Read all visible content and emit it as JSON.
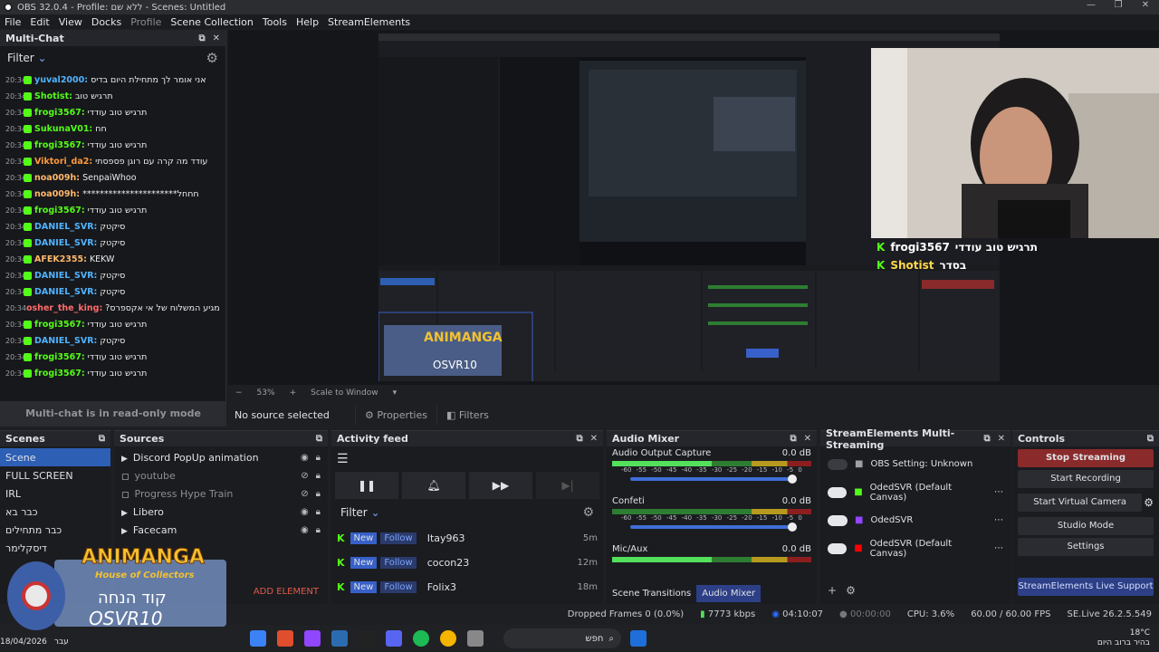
{
  "window": {
    "title": "OBS 32.0.4 - Profile: ללא שם - Scenes: Untitled"
  },
  "menu": [
    "File",
    "Edit",
    "View",
    "Docks",
    "Profile",
    "Scene Collection",
    "Tools",
    "Help",
    "StreamElements"
  ],
  "multichat": {
    "title": "Multi-Chat",
    "filter_label": "Filter",
    "readonly_text": "Multi-chat is in read-only mode",
    "lines": [
      {
        "time": "20:34",
        "user": "yuval2000:",
        "msg": "אני אומר לך מתחילת היום בדיס",
        "color": "#4fb3ff"
      },
      {
        "time": "20:34",
        "user": "Shotist:",
        "msg": "תרגיש טוב",
        "color": "#53fc18"
      },
      {
        "time": "20:34",
        "user": "frogi3567:",
        "msg": "תרגיש טוב עודדי",
        "color": "#53fc18"
      },
      {
        "time": "20:34",
        "user": "SukunaV01:",
        "msg": "חח",
        "color": "#53fc18"
      },
      {
        "time": "20:34",
        "user": "frogi3567:",
        "msg": "תרגיש טוב עודדי",
        "color": "#53fc18"
      },
      {
        "time": "20:34",
        "user": "Viktori_da2:",
        "msg": "עודד מה קרה עם רוגן פספסתי",
        "color": "#ff9a3c"
      },
      {
        "time": "20:34",
        "user": "noa009h:",
        "msg": "SenpaiWhoo",
        "color": "#ffb86b"
      },
      {
        "time": "20:34",
        "user": "noa009h:",
        "msg": "**********************חחחל",
        "color": "#ffb86b"
      },
      {
        "time": "20:34",
        "user": "frogi3567:",
        "msg": "תרגיש טוב עודדי",
        "color": "#53fc18"
      },
      {
        "time": "20:34",
        "user": "DANIEL_SVR:",
        "msg": "סיקטק",
        "color": "#4fb3ff"
      },
      {
        "time": "20:34",
        "user": "DANIEL_SVR:",
        "msg": "סיקטק",
        "color": "#4fb3ff"
      },
      {
        "time": "20:34",
        "user": "AFEK2355:",
        "msg": "KEKW",
        "color": "#ffb86b"
      },
      {
        "time": "20:34",
        "user": "DANIEL_SVR:",
        "msg": "סיקטק",
        "color": "#4fb3ff"
      },
      {
        "time": "20:34",
        "user": "DANIEL_SVR:",
        "msg": "סיקטק",
        "color": "#4fb3ff"
      },
      {
        "time": "20:34",
        "user": "osher_the_king:",
        "msg": "?מתי מגיע המשלוח של אי אקספרס",
        "color": "#ff6b6b"
      },
      {
        "time": "20:34",
        "user": "frogi3567:",
        "msg": "תרגיש טוב עודדי",
        "color": "#53fc18"
      },
      {
        "time": "20:34",
        "user": "DANIEL_SVR:",
        "msg": "סיקטק",
        "color": "#4fb3ff"
      },
      {
        "time": "20:34",
        "user": "frogi3567:",
        "msg": "תרגיש טוב עודדי",
        "color": "#53fc18"
      },
      {
        "time": "20:34",
        "user": "frogi3567:",
        "msg": "תרגיש טוב עודדי",
        "color": "#53fc18"
      },
      {
        "time": "20:34",
        "user": "Shotist:",
        "msg": "בסדר",
        "color": "#53fc18"
      }
    ]
  },
  "preview": {
    "zoom": "53%",
    "scale_mode": "Scale to Window",
    "overlay_lines": [
      {
        "user": "frogi3567",
        "msg": "תרגיש טוב עודדי",
        "color": "#ffffff"
      },
      {
        "user": "Shotist",
        "msg": "בסדר",
        "color": "#ffd84a"
      }
    ]
  },
  "sourcebar": {
    "no_source": "No source selected",
    "properties": "Properties",
    "filters": "Filters"
  },
  "scenes": {
    "title": "Scenes",
    "items": [
      "Scene",
      "FULL SCREEN",
      "IRL",
      "כבר בא",
      "כבר מתחילים",
      "דיסקלימר"
    ],
    "selected": 0
  },
  "sources": {
    "title": "Sources",
    "add_label": "ADD ELEMENT",
    "items": [
      {
        "name": "Discord PopUp animation",
        "dim": false
      },
      {
        "name": "youtube",
        "dim": true
      },
      {
        "name": "Progress Hype Train",
        "dim": true
      },
      {
        "name": "Libero",
        "dim": false
      },
      {
        "name": "Facecam",
        "dim": false
      }
    ]
  },
  "activity": {
    "title": "Activity feed",
    "filter_label": "Filter",
    "new_label": "New",
    "follow_label": "Follow",
    "items": [
      {
        "user": "Itay963",
        "age": "5m"
      },
      {
        "user": "cocon23",
        "age": "12m"
      },
      {
        "user": "Folix3",
        "age": "18m"
      }
    ]
  },
  "mixer": {
    "title": "Audio Mixer",
    "channels": [
      {
        "name": "Audio Output Capture",
        "db": "0.0 dB",
        "hot": true
      },
      {
        "name": "Confeti",
        "db": "0.0 dB",
        "hot": false
      },
      {
        "name": "Mic/Aux",
        "db": "0.0 dB",
        "hot": true
      }
    ],
    "ticks": [
      "-60",
      "-55",
      "-50",
      "-45",
      "-40",
      "-35",
      "-30",
      "-25",
      "-20",
      "-15",
      "-10",
      "-5",
      "0"
    ],
    "tab_transitions": "Scene Transitions",
    "tab_mixer": "Audio Mixer"
  },
  "se_multi": {
    "title": "StreamElements Multi-Streaming",
    "rows": [
      {
        "label": "OBS Setting: Unknown",
        "on": false,
        "platform": "obs",
        "color": "#9aa0a6"
      },
      {
        "label": "OdedSVR (Default Canvas)",
        "on": true,
        "platform": "kick",
        "color": "#53fc18"
      },
      {
        "label": "OdedSVR",
        "on": true,
        "platform": "twitch",
        "color": "#9146ff"
      },
      {
        "label": "OdedSVR (Default Canvas)",
        "on": true,
        "platform": "youtube",
        "color": "#ff0000"
      }
    ]
  },
  "controls": {
    "title": "Controls",
    "stop_streaming": "Stop Streaming",
    "start_recording": "Start Recording",
    "start_virtual_camera": "Start Virtual Camera",
    "studio_mode": "Studio Mode",
    "settings": "Settings",
    "support": "StreamElements Live Support"
  },
  "status": {
    "dropped": "Dropped Frames 0 (0.0%)",
    "kbps": "7773 kbps",
    "live_time": "04:10:07",
    "rec_time": "00:00:00",
    "cpu": "CPU: 3.6%",
    "fps": "60.00 / 60.00 FPS",
    "version": "SE.Live 26.2.5.549"
  },
  "taskbar": {
    "search_placeholder": "חפש",
    "date": "18/04/2026",
    "lang": "עבר",
    "weather": "18°C",
    "weather_desc": "בהיר ברוב היום"
  },
  "overlay_logo": {
    "title": "ANIMANGA",
    "subtitle": "House of Collectors",
    "code_label": "קוד הנחה",
    "code": "OSVR10"
  }
}
